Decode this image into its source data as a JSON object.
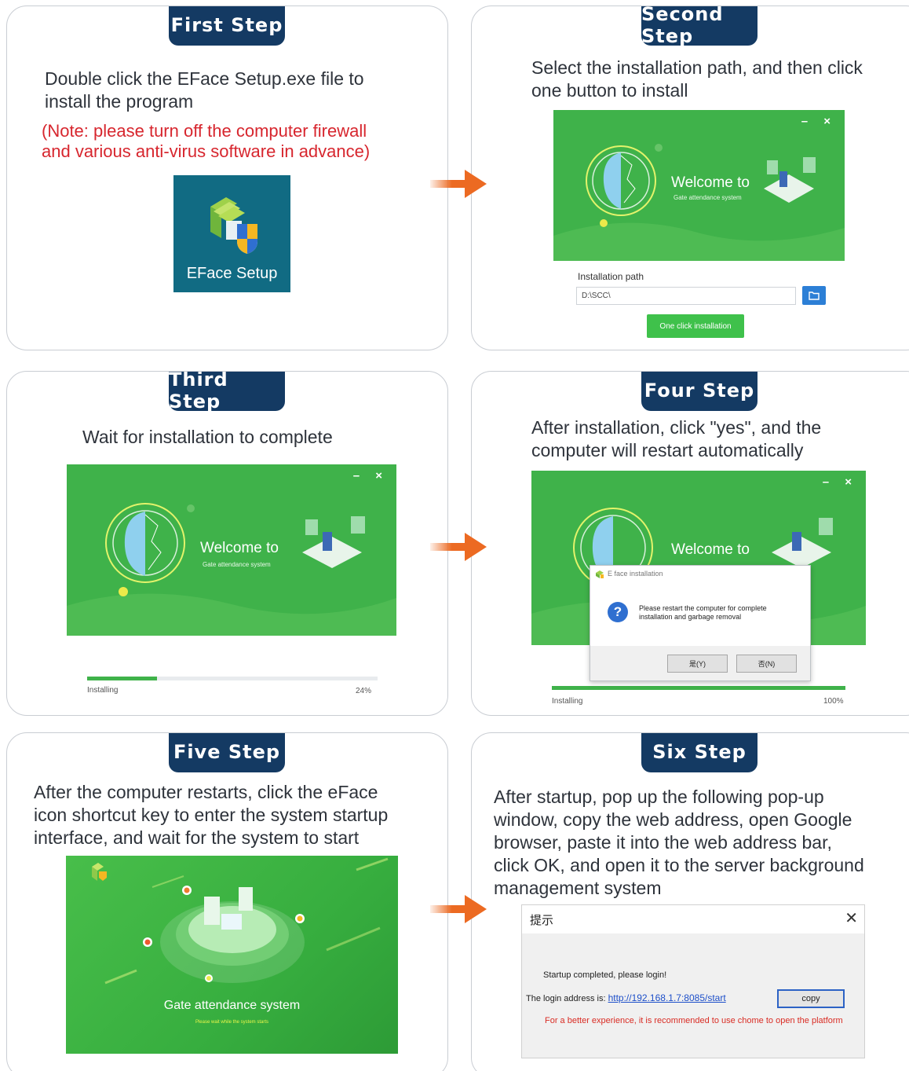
{
  "arrow_color": "#ec6a22",
  "badge_color": "#143a63",
  "installer_green": "#3fb24a",
  "steps": [
    {
      "badge": "First Step",
      "description_lines": [
        "Double click the EFace Setup.exe file to",
        "install the program"
      ],
      "note_lines": [
        "(Note: please turn off the computer firewall",
        "and various anti-virus software in advance)"
      ],
      "icon_label": "EFace Setup"
    },
    {
      "badge": "Second Step",
      "description_lines": [
        "Select the installation path, and then click",
        "one button to install"
      ],
      "welcome": "Welcome to",
      "welcome_sub": "Gate attendance system",
      "window_controls": "– ×",
      "path_label": "Installation path",
      "path_value": "D:\\SCC\\",
      "install_button": "One click installation"
    },
    {
      "badge": "Third Step",
      "description": "Wait for installation to complete",
      "welcome": "Welcome to",
      "welcome_sub": "Gate attendance system",
      "window_controls": "– ×",
      "progress_label": "Installing",
      "progress_percent": "24%",
      "progress_fraction": 0.24
    },
    {
      "badge": "Four Step",
      "description_lines": [
        "After installation, click \"yes\", and the",
        "computer will restart automatically"
      ],
      "welcome": "Welcome to",
      "window_controls": "– ×",
      "dialog_title": "E face installation",
      "dialog_message_lines": [
        "Please restart the computer for complete",
        "installation and garbage removal"
      ],
      "dialog_yes": "是(Y)",
      "dialog_no": "否(N)",
      "progress_label": "Installing",
      "progress_percent": "100%",
      "progress_fraction": 1.0
    },
    {
      "badge": "Five Step",
      "description_lines": [
        "After the computer restarts, click the eFace",
        "icon shortcut key to enter the system startup",
        "interface, and wait for the system to start"
      ],
      "startup_title": "Gate attendance system",
      "startup_sub": "Please wait while the system starts"
    },
    {
      "badge": "Six Step",
      "description_lines": [
        "After startup, pop up the following pop-up",
        "window, copy the web address, open Google",
        "browser, paste it into the web address bar,",
        "click OK, and open it to the server background",
        "management system"
      ],
      "prompt_title": "提示",
      "prompt_close": "✕",
      "prompt_line1": "Startup completed, please login!",
      "prompt_address_label": "The login address is:",
      "prompt_address": "http://192.168.1.7:8085/start",
      "copy_button": "copy",
      "prompt_warning": "For a better experience, it is recommended to use chome to open the platform"
    }
  ]
}
